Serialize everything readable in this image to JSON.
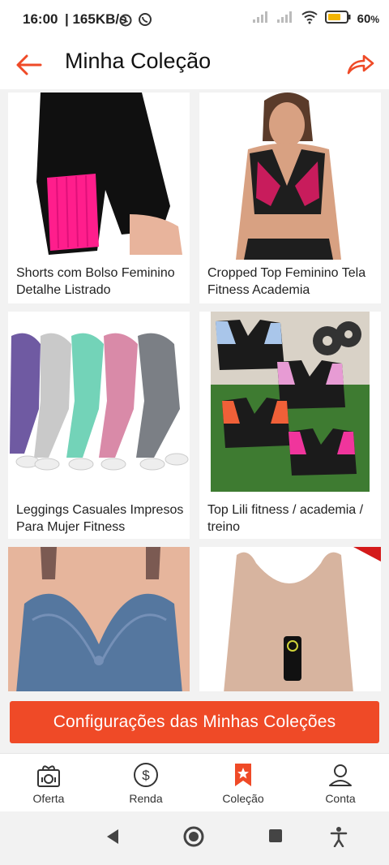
{
  "status_bar": {
    "time": "16:00",
    "speed": "| 165KB/s",
    "battery": "60"
  },
  "header": {
    "title": "Minha Coleção"
  },
  "products": [
    {
      "caption": "Shorts com Bolso Feminino Detalhe Listrado"
    },
    {
      "caption": "Cropped Top Feminino Tela Fitness Academia"
    },
    {
      "caption": "Leggings Casuales Impresos Para Mujer Fitness"
    },
    {
      "caption": "Top Lili fitness / academia / treino"
    },
    {
      "caption": ""
    },
    {
      "caption": ""
    }
  ],
  "cta": {
    "label": "Configurações das Minhas Coleções"
  },
  "tabs": [
    {
      "label": "Oferta",
      "icon": "gift-icon"
    },
    {
      "label": "Renda",
      "icon": "dollar-icon"
    },
    {
      "label": "Coleção",
      "icon": "bookmark-star-icon"
    },
    {
      "label": "Conta",
      "icon": "user-icon"
    }
  ],
  "colors": {
    "accent": "#ef4a27"
  }
}
